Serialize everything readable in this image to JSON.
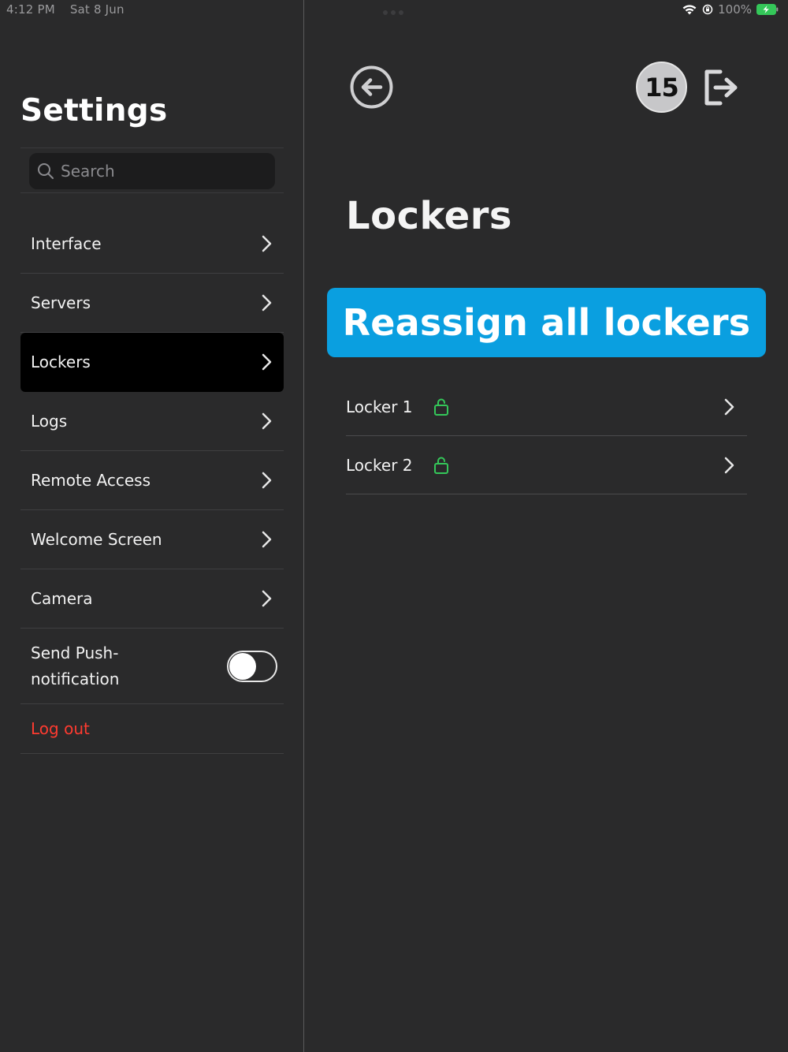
{
  "status_bar": {
    "time": "4:12 PM",
    "date": "Sat 8 Jun",
    "battery": "100%"
  },
  "sidebar": {
    "title": "Settings",
    "search_placeholder": "Search",
    "items": [
      {
        "label": "Interface"
      },
      {
        "label": "Servers"
      },
      {
        "label": "Lockers",
        "active": true
      },
      {
        "label": "Logs"
      },
      {
        "label": "Remote Access"
      },
      {
        "label": "Welcome Screen"
      },
      {
        "label": "Camera"
      }
    ],
    "push_notification": {
      "label": "Send Push-notification",
      "enabled": false
    },
    "logout_label": "Log out"
  },
  "detail": {
    "badge_count": "15",
    "title": "Lockers",
    "reassign_label": "Reassign all lockers",
    "lockers": [
      {
        "name": "Locker 1",
        "status": "unlocked"
      },
      {
        "name": "Locker 2",
        "status": "unlocked"
      }
    ]
  },
  "colors": {
    "background": "#2a2a2b",
    "accent": "#0a9fe0",
    "unlocked": "#34c759",
    "destructive": "#ff3b30"
  }
}
